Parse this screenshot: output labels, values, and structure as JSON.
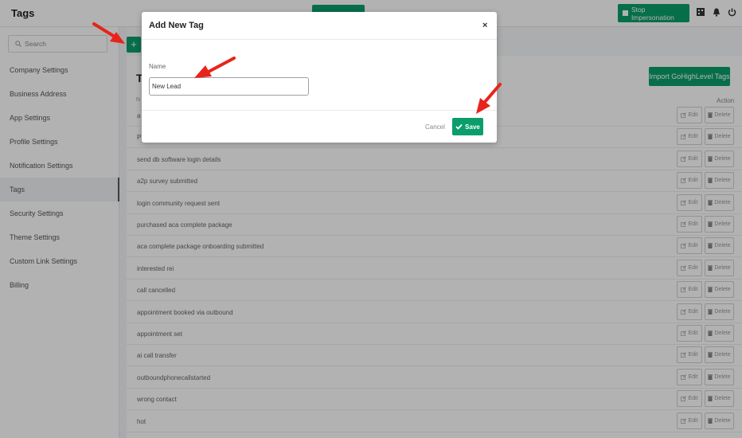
{
  "header": {
    "title": "Tags",
    "stop_impersonation": "Stop Impersonation"
  },
  "sidebar": {
    "search_placeholder": "Search",
    "items": [
      {
        "label": "Company Settings"
      },
      {
        "label": "Business Address"
      },
      {
        "label": "App Settings"
      },
      {
        "label": "Profile Settings"
      },
      {
        "label": "Notification Settings"
      },
      {
        "label": "Tags",
        "active": true
      },
      {
        "label": "Security Settings"
      },
      {
        "label": "Theme Settings"
      },
      {
        "label": "Custom Link Settings"
      },
      {
        "label": "Billing"
      }
    ]
  },
  "main": {
    "plus": "+",
    "heading_visible": "T",
    "import_button": "Import GoHighLevel Tags",
    "column_name_visible": "N",
    "column_action": "Action",
    "row_actions": {
      "edit": "Edit",
      "delete": "Delete"
    },
    "tags": [
      "a",
      "P",
      "send db software login details",
      "a2p survey submitted",
      "login community request sent",
      "purchased aca complete package",
      "aca complete package onboarding submitted",
      "interested rei",
      "call cancelled",
      "appointment booked via outbound",
      "appointment set",
      "ai call transfer",
      "outboundphonecallstarted",
      "wrong contact",
      "hot"
    ]
  },
  "modal": {
    "title": "Add New Tag",
    "close": "×",
    "name_label": "Name",
    "name_value": "New Lead",
    "cancel": "Cancel",
    "save": "Save"
  },
  "colors": {
    "accent": "#0b9e6b",
    "annotation_arrow": "#e8231a"
  },
  "icons": [
    "search-icon",
    "grid-icon",
    "bell-icon",
    "power-icon",
    "edit-icon",
    "trash-icon",
    "check-icon",
    "close-icon",
    "plus-icon"
  ]
}
